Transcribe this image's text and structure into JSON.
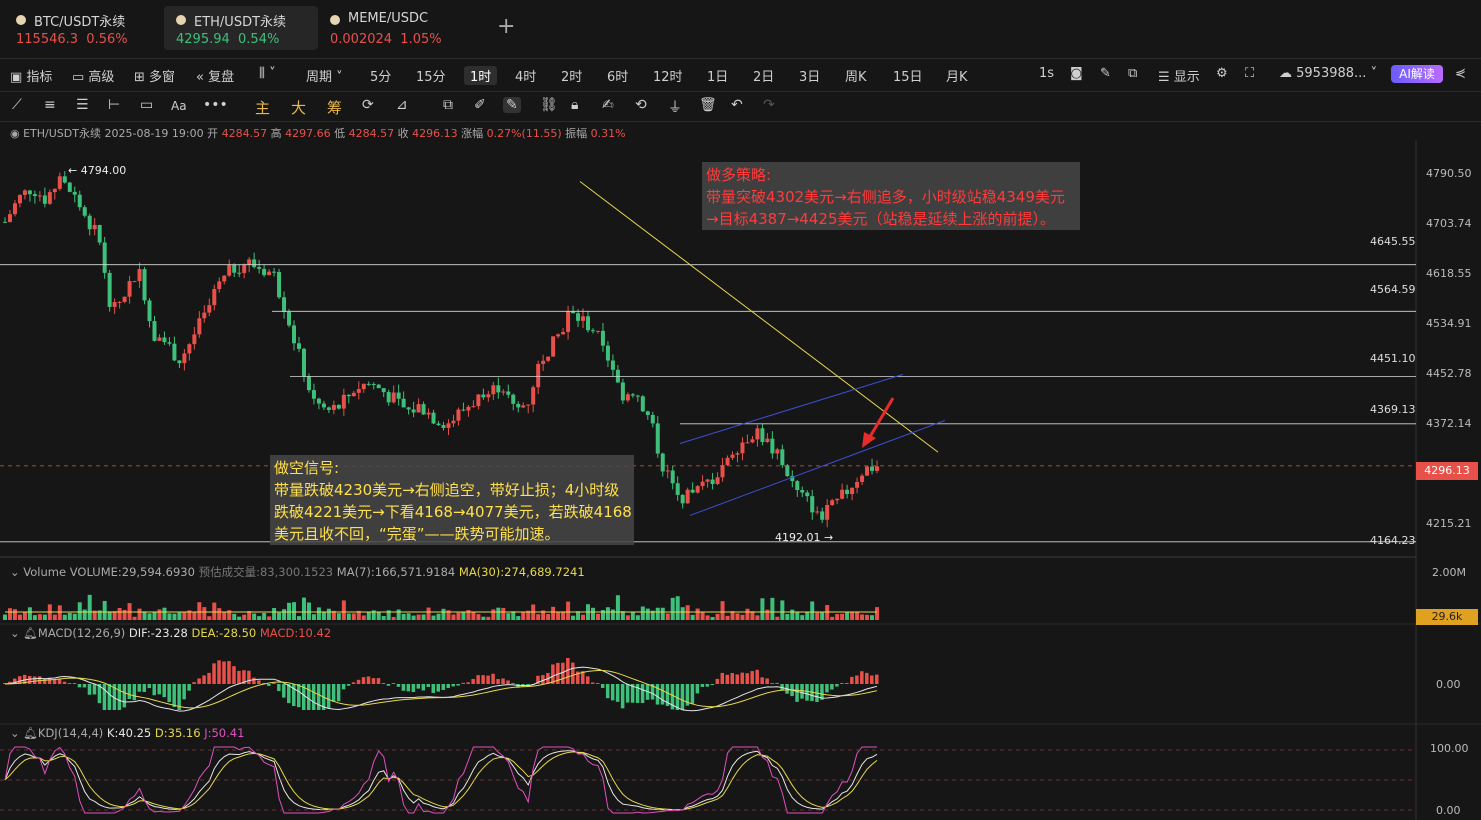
{
  "tabs": [
    {
      "name": "BTC/USDT永续",
      "price": "115546.3",
      "change": "0.56%",
      "color": "#e8504a"
    },
    {
      "name": "ETH/USDT永续",
      "price": "4295.94",
      "change": "0.54%",
      "color": "#3ec07a"
    },
    {
      "name": "MEME/USDC",
      "price": "0.002024",
      "change": "1.05%",
      "color": "#e8504a"
    }
  ],
  "toolbar": {
    "indicators": "指标",
    "advanced": "高级",
    "multi_window": "多窗",
    "replay": "复盘",
    "period": "周期",
    "intervals": [
      "5分",
      "15分",
      "1时",
      "4时",
      "2时",
      "6时",
      "12时",
      "1日",
      "2日",
      "3日",
      "周K",
      "15日",
      "月K"
    ],
    "active_interval": "1时",
    "seconds": "1s",
    "display": "显示",
    "account": "5953988...",
    "ai": "AI解读"
  },
  "drawtools": {
    "main": "主",
    "big": "大",
    "chip": "筹"
  },
  "info": {
    "symbol": "ETH/USDT永续",
    "datetime": "2025-08-19 19:00",
    "open_label": "开",
    "open": "4284.57",
    "high_label": "高",
    "high": "4297.66",
    "low_label": "低",
    "low": "4284.57",
    "close_label": "收",
    "close": "4296.13",
    "chg_label": "涨幅",
    "chg": "0.27%(11.55)",
    "amp_label": "振幅",
    "amp": "0.31%"
  },
  "annotations": {
    "long_title": "做多策略:",
    "long_line1": "带量突破4302美元→右侧追多，小时级站稳4349美元",
    "long_line2": "→目标4387→4425美元（站稳是延续上涨的前提）。",
    "short_title": "做空信号:",
    "short_line1": "带量跌破4230美元→右侧追空，带好止损；4小时级",
    "short_line2": "跌破4221美元→下看4168→4077美元，若跌破4168",
    "short_line3": "美元且收不回，“完蛋”——跌势可能加速。"
  },
  "price_axis": {
    "ticks": [
      "4790.50",
      "4703.74",
      "4618.55",
      "4534.91",
      "4452.78",
      "4372.14",
      "4296.13",
      "4215.21"
    ],
    "current": "4296.13"
  },
  "levels": [
    "4645.55",
    "4564.59",
    "4451.10",
    "4369.13",
    "4164.23"
  ],
  "extremes": {
    "high": "4794.00",
    "low": "4192.01"
  },
  "volume": {
    "label": "Volume",
    "vol": "VOLUME:29,594.6930",
    "est": "预估成交量:83,300.1523",
    "ma7": "MA(7):166,571.9184",
    "ma30": "MA(30):274,689.7241",
    "axis_top": "2.00M",
    "axis_cur": "29.6k"
  },
  "macd": {
    "label": "MACD(12,26,9)",
    "dif": "DIF:-23.28",
    "dea": "DEA:-28.50",
    "macd": "MACD:10.42",
    "axis": "0.00"
  },
  "kdj": {
    "label": "KDJ(14,4,4)",
    "k": "K:40.25",
    "d": "D:35.16",
    "j": "J:50.41",
    "axis_top": "100.00",
    "axis_bot": "0.00"
  },
  "colors": {
    "up": "#e8504a",
    "down": "#3ec07a",
    "level": "#d8d8d8",
    "trend": "#e6d84a",
    "channel": "#3d4fd6",
    "arrow": "#e82b2b"
  },
  "chart_data": {
    "type": "candlestick",
    "symbol": "ETH/USDT永续",
    "interval": "1时",
    "ylim": [
      4150,
      4810
    ],
    "close_path": [
      4720,
      4760,
      4780,
      4760,
      4790,
      4770,
      4730,
      4690,
      4560,
      4600,
      4640,
      4530,
      4510,
      4480,
      4520,
      4560,
      4610,
      4640,
      4650,
      4640,
      4630,
      4560,
      4480,
      4410,
      4390,
      4400,
      4430,
      4440,
      4430,
      4410,
      4390,
      4400,
      4380,
      4370,
      4390,
      4410,
      4420,
      4440,
      4390,
      4410,
      4490,
      4510,
      4560,
      4550,
      4530,
      4470,
      4420,
      4430,
      4380,
      4300,
      4250,
      4240,
      4260,
      4280,
      4320,
      4340,
      4360,
      4330,
      4300,
      4250,
      4230,
      4210,
      4230,
      4260,
      4290,
      4296
    ]
  }
}
